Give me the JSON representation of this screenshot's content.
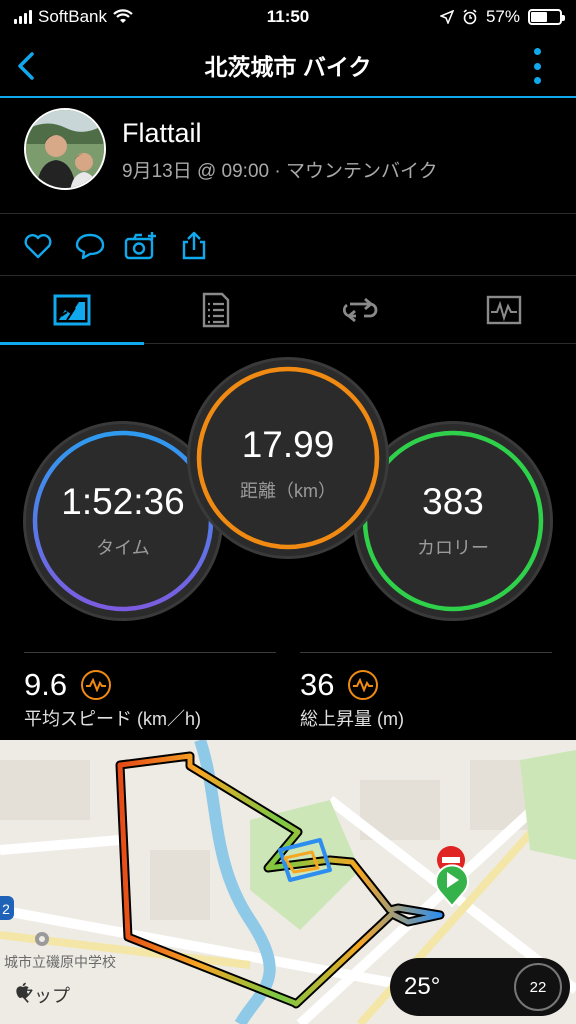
{
  "status_bar": {
    "carrier": "SoftBank",
    "time": "11:50",
    "battery": "57%",
    "battery_level": 0.57
  },
  "nav": {
    "title": "北茨城市 バイク"
  },
  "profile": {
    "name": "Flattail",
    "meta": "9月13日 @ 09:00 · マウンテンバイク"
  },
  "actions": {
    "icons": [
      "heart-icon",
      "comment-icon",
      "add-photo-icon",
      "share-icon"
    ]
  },
  "tabs": {
    "icons": [
      "summary-chart-icon",
      "details-list-icon",
      "laps-icon",
      "graph-icon"
    ],
    "active": 0
  },
  "rings": {
    "distance": {
      "value": "17.99",
      "label": "距離（km）",
      "color": "#f08a12"
    },
    "time": {
      "value": "1:52:36",
      "label": "タイム",
      "colors": [
        "#2e9bf0",
        "#7c5ce0"
      ]
    },
    "calories": {
      "value": "383",
      "label": "カロリー",
      "color": "#2fd14a"
    }
  },
  "stats": {
    "avg_speed": {
      "value": "9.6",
      "label": "平均スピード (km／h)"
    },
    "elevation": {
      "value": "36",
      "label": "総上昇量 (m)"
    }
  },
  "map": {
    "school_label": "城市立磯原中学校",
    "route_label": "2",
    "attribution": "マップ",
    "weather_temp": "25°",
    "aqi": "22"
  },
  "colors": {
    "accent": "#11a9ed",
    "orange": "#f08a12"
  }
}
